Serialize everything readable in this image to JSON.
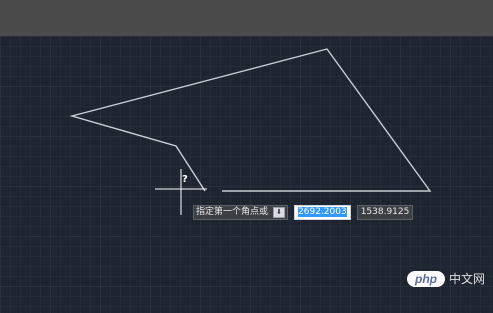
{
  "dynamic_input": {
    "prompt": "指定第一个角点或",
    "down_arrow": "⬇",
    "x_value": "2692.2003",
    "y_value": "1538.9125"
  },
  "cursor": {
    "help_mark": "?"
  },
  "watermark": {
    "logo": "php",
    "text": "中文网"
  },
  "colors": {
    "background": "#1f2530",
    "grid": "#2a313d",
    "polyline": "#c9cdd4",
    "crosshair": "#ffffff",
    "selection": "#3399ff"
  }
}
